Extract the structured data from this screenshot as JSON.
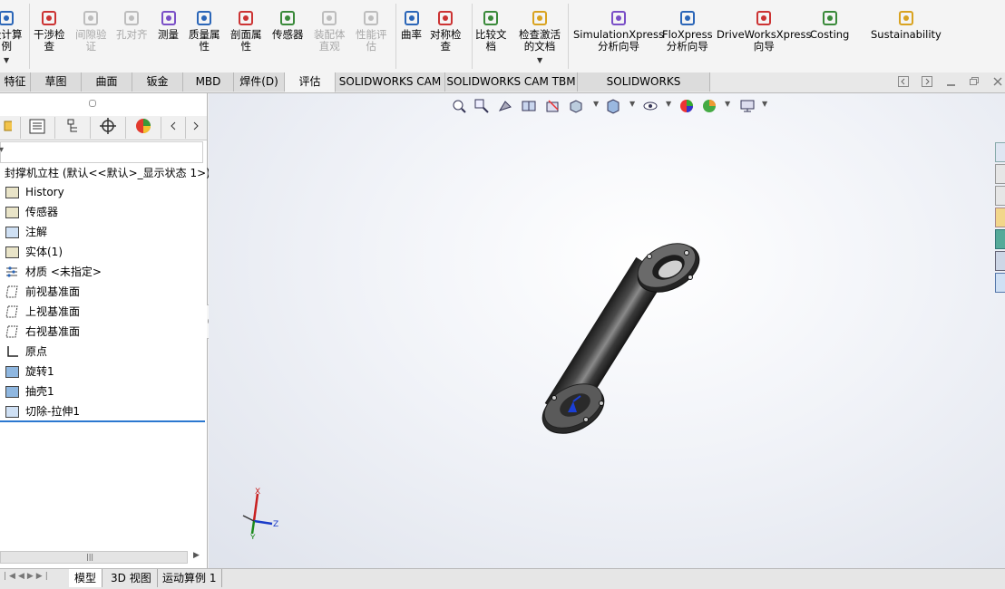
{
  "ribbon": {
    "buttons": [
      {
        "label": "设计算\n例",
        "icon": "design-study-icon",
        "enabled": true
      },
      {
        "label": "干涉检\n查",
        "icon": "interference-check-icon",
        "enabled": true
      },
      {
        "label": "间隙验\n证",
        "icon": "clearance-verification-icon",
        "enabled": false
      },
      {
        "label": "孔对齐",
        "icon": "hole-alignment-icon",
        "enabled": false
      },
      {
        "label": "测量",
        "icon": "measure-icon",
        "enabled": true
      },
      {
        "label": "质量属\n性",
        "icon": "mass-properties-icon",
        "enabled": true
      },
      {
        "label": "剖面属\n性",
        "icon": "section-properties-icon",
        "enabled": true
      },
      {
        "label": "传感器",
        "icon": "sensor-icon",
        "enabled": true
      },
      {
        "label": "装配体\n直观",
        "icon": "assembly-visualization-icon",
        "enabled": false
      },
      {
        "label": "性能评\n估",
        "icon": "performance-evaluation-icon",
        "enabled": false
      },
      {
        "label": "曲率",
        "icon": "curvature-icon",
        "enabled": true
      },
      {
        "label": "对称检\n查",
        "icon": "symmetry-check-icon",
        "enabled": true
      },
      {
        "label": "比较文\n档",
        "icon": "compare-documents-icon",
        "enabled": true
      },
      {
        "label": "检查激活\n的文档",
        "icon": "check-active-document-icon",
        "enabled": true
      },
      {
        "label": "SimulationXpress\n分析向导",
        "icon": "simulationxpress-icon",
        "enabled": true
      },
      {
        "label": "FloXpress\n分析向导",
        "icon": "floxpress-icon",
        "enabled": true
      },
      {
        "label": "DriveWorksXpress\n向导",
        "icon": "driveworksxpress-icon",
        "enabled": true
      },
      {
        "label": "Costing",
        "icon": "costing-icon",
        "enabled": true
      },
      {
        "label": "Sustainability",
        "icon": "sustainability-icon",
        "enabled": true
      }
    ]
  },
  "command_tabs": [
    "特征",
    "草图",
    "曲面",
    "钣金",
    "MBD",
    "焊件(D)",
    "评估",
    "SOLIDWORKS CAM",
    "SOLIDWORKS CAM TBM",
    "SOLIDWORKS Inspection"
  ],
  "active_command_tab": "评估",
  "feature_tree": {
    "root": "封撑机立柱 (默认<<默认>_显示状态 1>)",
    "items": [
      {
        "label": "History",
        "icon": "history-folder-icon"
      },
      {
        "label": "传感器",
        "icon": "sensors-folder-icon"
      },
      {
        "label": "注解",
        "icon": "annotations-icon"
      },
      {
        "label": "实体(1)",
        "icon": "solid-bodies-folder-icon"
      },
      {
        "label": "材质 <未指定>",
        "icon": "material-icon"
      },
      {
        "label": "前视基准面",
        "icon": "plane-icon"
      },
      {
        "label": "上视基准面",
        "icon": "plane-icon"
      },
      {
        "label": "右视基准面",
        "icon": "plane-icon"
      },
      {
        "label": "原点",
        "icon": "origin-icon"
      },
      {
        "label": "旋转1",
        "icon": "revolve-feature-icon"
      },
      {
        "label": "抽壳1",
        "icon": "shell-feature-icon"
      },
      {
        "label": "切除-拉伸1",
        "icon": "cut-extrude-feature-icon"
      }
    ]
  },
  "bottom_tabs": [
    "模型",
    "3D 视图",
    "运动算例 1"
  ],
  "active_bottom_tab": "模型",
  "triad": {
    "x": "X",
    "y": "Y",
    "z": "Z"
  },
  "colors": {
    "accent": "#2b66b8",
    "selection_line": "#2b78d0",
    "model_dark": "#2a2a2a"
  }
}
